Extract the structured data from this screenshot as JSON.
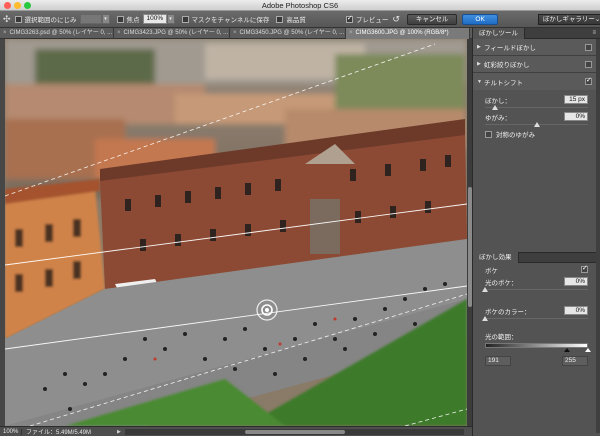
{
  "window": {
    "title": "Adobe Photoshop CS6"
  },
  "colors": {
    "accent": "#2a78d2",
    "close": "#ff5f57",
    "minimize": "#febc2e",
    "zoom": "#28c840"
  },
  "options_bar": {
    "tool_icon": "blur-gallery-pin-icon",
    "select_bokeh_label": "選択範囲のにじみ",
    "select_bokeh_value": "",
    "focus_label": "焦点",
    "focus_value": "100%",
    "save_mask_label": "マスクをチャンネルに保存",
    "high_quality_label": "高品質",
    "preview_label": "プレビュー",
    "cancel_label": "キャンセル",
    "ok_label": "OK",
    "gallery_dropdown": "ぼかしギャラリー"
  },
  "tabs": [
    {
      "label": "CIMG3263.psd @ 50% (レイヤー 0, ..."
    },
    {
      "label": "CIMG3423.JPG @ 50% (レイヤー 0, ..."
    },
    {
      "label": "CIMG3450.JPG @ 50% (レイヤー 0, ..."
    },
    {
      "label": "CIMG3600.JPG @ 100% (RGB/8*)"
    }
  ],
  "status_bar": {
    "zoom": "100%",
    "file_info": "ファイル：5.49M/5.49M"
  },
  "panel": {
    "tab_label": "ぼかしツール",
    "field_blur": {
      "label": "フィールドぼかし",
      "enabled": false
    },
    "iris_blur": {
      "label": "虹彩絞りぼかし",
      "enabled": false
    },
    "tilt_shift": {
      "label": "チルトシフト",
      "enabled": true,
      "blur_label": "ぼかし：",
      "blur_value": "15 px",
      "blur_level": 0.1,
      "distortion_label": "ゆがみ：",
      "distortion_value": "0%",
      "distortion_level": 0.5,
      "symmetric_label": "対称のゆがみ"
    },
    "effects_tab_label": "ぼかし効果",
    "bokeh_label": "ボケ",
    "bokeh_enabled": true,
    "light_bokeh_label": "光のボケ：",
    "light_bokeh_value": "0%",
    "light_bokeh_level": 0.0,
    "bokeh_color_label": "ボケのカラー：",
    "bokeh_color_value": "0%",
    "bokeh_color_level": 0.0,
    "light_range_label": "光の範囲：",
    "light_range_min": "191",
    "light_range_max": "255"
  }
}
